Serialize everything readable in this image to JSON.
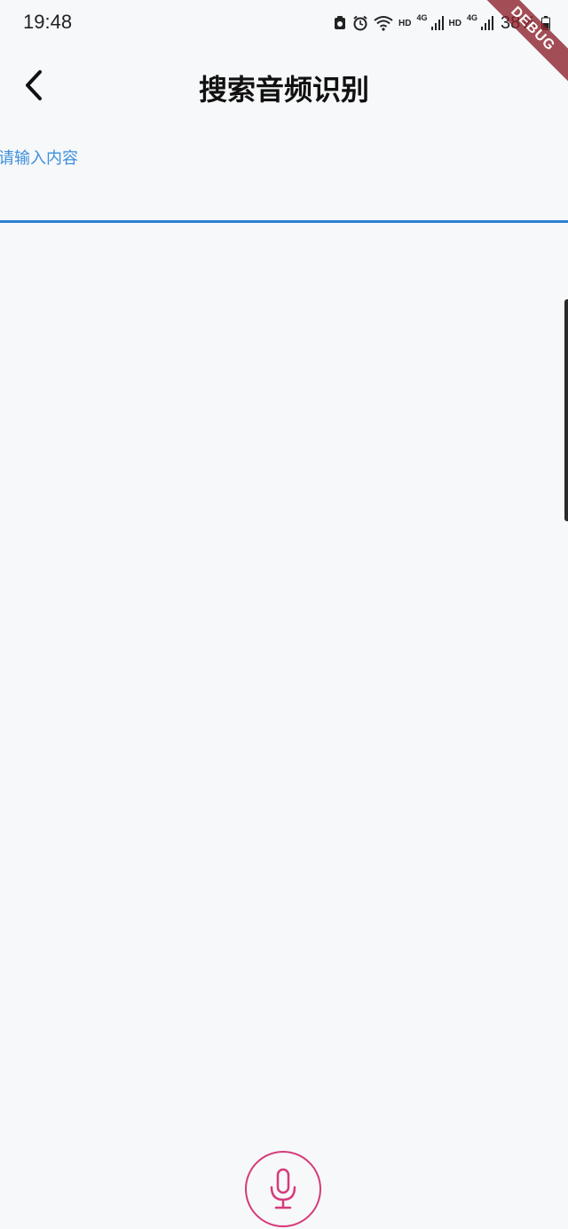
{
  "status_bar": {
    "time": "19:48",
    "hd1": "HD",
    "net1": "4G",
    "hd2": "HD",
    "net2": "4G",
    "battery": "38%"
  },
  "debug_banner": "DEBUG",
  "app_bar": {
    "title": "搜索音频识别",
    "back_icon": "chevron-left-icon"
  },
  "search": {
    "placeholder": "请输入内容",
    "value": ""
  },
  "mic": {
    "icon": "microphone-icon"
  },
  "colors": {
    "accent": "#2f80d4",
    "hint": "#3d8fdc",
    "mic": "#d63a7a",
    "background": "#f7f8fa"
  }
}
